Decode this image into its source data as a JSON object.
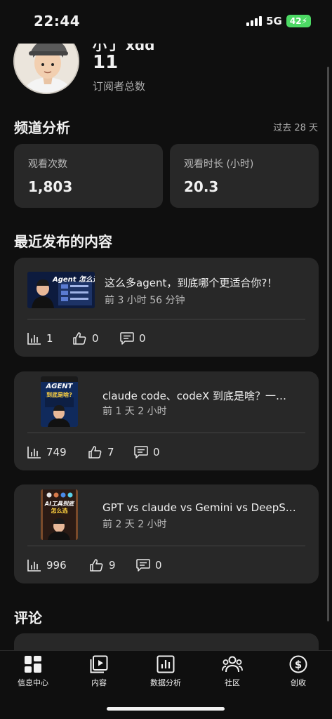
{
  "status_bar": {
    "time": "22:44",
    "network": "5G",
    "battery": "42"
  },
  "channel": {
    "name": "小丁 xdd",
    "subscriber_count": "11",
    "subscriber_label": "订阅者总数"
  },
  "analytics": {
    "title": "频道分析",
    "period": "过去 28 天",
    "views_label": "观看次数",
    "views_value": "1,803",
    "watch_time_label": "观看时长 (小时)",
    "watch_time_value": "20.3"
  },
  "recent": {
    "title": "最近发布的内容",
    "videos": [
      {
        "title": "这么多agent，到底哪个更适合你?！",
        "time": "前 3 小时 56 分钟",
        "views": "1",
        "likes": "0",
        "comments": "0",
        "thumb_text": "Agent 怎么选?"
      },
      {
        "title": "claude code、codeX 到底是啥？一…",
        "time": "前 1 天 2 小时",
        "views": "749",
        "likes": "7",
        "comments": "0",
        "thumb_text_1": "AGENT",
        "thumb_text_2": "到底是啥?"
      },
      {
        "title": "GPT vs claude vs Gemini vs DeepS…",
        "time": "前 2 天 2 小时",
        "views": "996",
        "likes": "9",
        "comments": "0",
        "thumb_text_1": "AI工具到底",
        "thumb_text_2": "怎么选"
      }
    ]
  },
  "comments": {
    "title": "评论"
  },
  "nav": {
    "dashboard": "信息中心",
    "content": "内容",
    "analytics": "数据分析",
    "community": "社区",
    "earn": "创收"
  },
  "colors": {
    "background": "#0f0f0f",
    "card": "#282828",
    "battery": "#4cd964"
  }
}
